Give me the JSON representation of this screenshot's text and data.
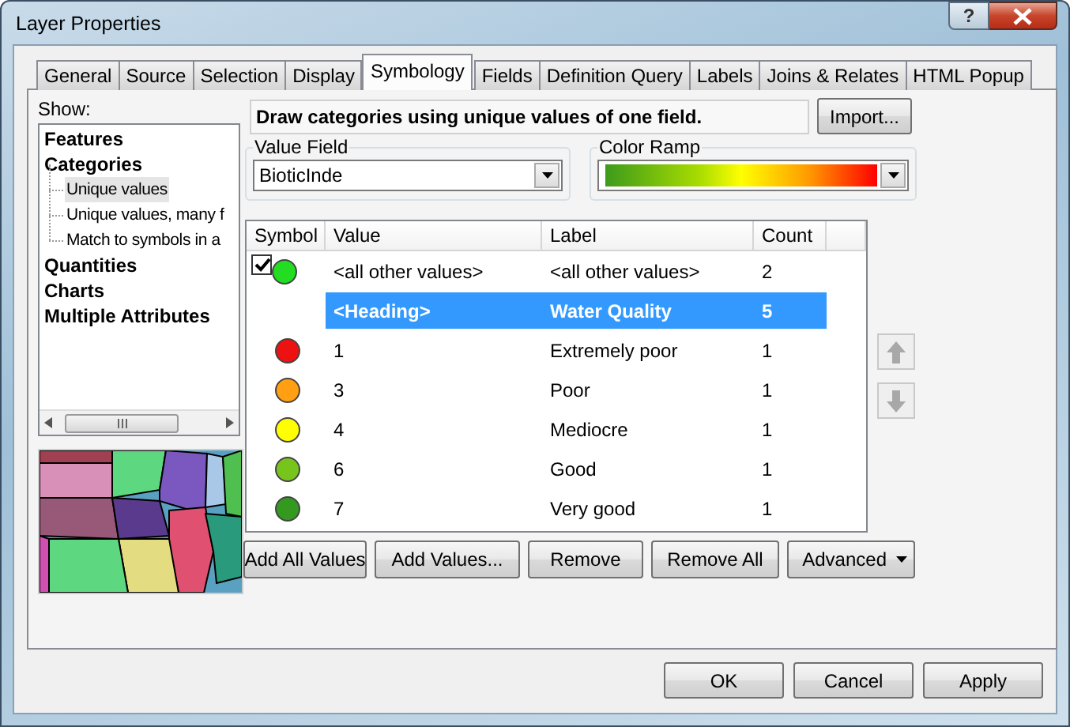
{
  "window": {
    "title": "Layer Properties",
    "help": "?"
  },
  "tabs": [
    {
      "label": "General",
      "selected": false
    },
    {
      "label": "Source",
      "selected": false
    },
    {
      "label": "Selection",
      "selected": false
    },
    {
      "label": "Display",
      "selected": false
    },
    {
      "label": "Symbology",
      "selected": true
    },
    {
      "label": "Fields",
      "selected": false
    },
    {
      "label": "Definition Query",
      "selected": false
    },
    {
      "label": "Labels",
      "selected": false
    },
    {
      "label": "Joins & Relates",
      "selected": false
    },
    {
      "label": "HTML Popup",
      "selected": false
    }
  ],
  "show_label": "Show:",
  "tree": [
    {
      "label": "Features",
      "selected": false
    },
    {
      "label": "Categories",
      "selected": false,
      "children": [
        {
          "label": "Unique values",
          "selected": true
        },
        {
          "label": "Unique values, many f",
          "selected": false
        },
        {
          "label": "Match to symbols in a",
          "selected": false
        }
      ]
    },
    {
      "label": "Quantities",
      "selected": false
    },
    {
      "label": "Charts",
      "selected": false
    },
    {
      "label": "Multiple Attributes",
      "selected": false
    }
  ],
  "description": "Draw categories using unique values of one field.",
  "import_button": "Import...",
  "value_field": {
    "legend": "Value Field",
    "value": "BioticInde"
  },
  "color_ramp": {
    "legend": "Color Ramp"
  },
  "table": {
    "columns": [
      "Symbol",
      "Value",
      "Label",
      "Count"
    ],
    "rows": [
      {
        "kind": "other",
        "checked": true,
        "color": "#22dd22",
        "value": "<all other values>",
        "label": "<all other values>",
        "count": "2",
        "selected": false
      },
      {
        "kind": "heading",
        "value": "<Heading>",
        "label": "Water Quality",
        "count": "5",
        "selected": true
      },
      {
        "kind": "value",
        "color": "#ee1111",
        "value": "1",
        "label": "Extremely poor",
        "count": "1",
        "selected": false
      },
      {
        "kind": "value",
        "color": "#ff9f11",
        "value": "3",
        "label": "Poor",
        "count": "1",
        "selected": false
      },
      {
        "kind": "value",
        "color": "#ffff00",
        "value": "4",
        "label": "Mediocre",
        "count": "1",
        "selected": false
      },
      {
        "kind": "value",
        "color": "#77c51c",
        "value": "6",
        "label": "Good",
        "count": "1",
        "selected": false
      },
      {
        "kind": "value",
        "color": "#339a1f",
        "value": "7",
        "label": "Very good",
        "count": "1",
        "selected": false
      }
    ]
  },
  "action_buttons": [
    {
      "label": "Add All Values",
      "kind": "plain"
    },
    {
      "label": "Add Values...",
      "kind": "plain"
    },
    {
      "label": "Remove",
      "kind": "plain"
    },
    {
      "label": "Remove All",
      "kind": "plain"
    },
    {
      "label": "Advanced",
      "kind": "menu"
    }
  ],
  "dialog_buttons": [
    "OK",
    "Cancel",
    "Apply"
  ]
}
